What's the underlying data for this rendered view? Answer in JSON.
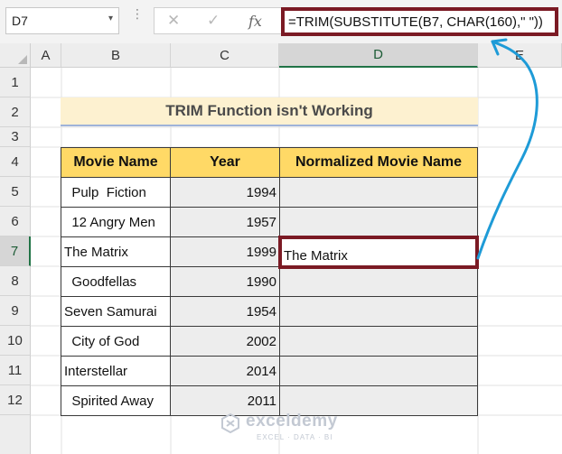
{
  "formula_bar": {
    "name_box": "D7",
    "name_box_arrow": "▾",
    "cancel_glyph": "✕",
    "enter_glyph": "✓",
    "fx_glyph": "fx",
    "formula": "=TRIM(SUBSTITUTE(B7, CHAR(160),\" \"))"
  },
  "columns": [
    "A",
    "B",
    "C",
    "D",
    "E"
  ],
  "rows": [
    "1",
    "2",
    "3",
    "4",
    "5",
    "6",
    "7",
    "8",
    "9",
    "10",
    "11",
    "12"
  ],
  "title": "TRIM Function isn't Working",
  "table": {
    "headers": [
      "Movie Name",
      "Year",
      "Normalized Movie Name"
    ],
    "rows": [
      {
        "name": "  Pulp  Fiction",
        "year": "1994",
        "normalized": ""
      },
      {
        "name": "  12 Angry Men",
        "year": "1957",
        "normalized": ""
      },
      {
        "name": "The Matrix",
        "year": "1999",
        "normalized": "The Matrix"
      },
      {
        "name": "  Goodfellas",
        "year": "1990",
        "normalized": ""
      },
      {
        "name": "Seven Samurai",
        "year": "1954",
        "normalized": ""
      },
      {
        "name": "  City of God",
        "year": "2002",
        "normalized": ""
      },
      {
        "name": "Interstellar",
        "year": "2014",
        "normalized": ""
      },
      {
        "name": "  Spirited Away",
        "year": "2011",
        "normalized": ""
      }
    ]
  },
  "active_cell": "D7",
  "watermark": {
    "name": "exceldemy",
    "tagline": "EXCEL · DATA · BI"
  },
  "colors": {
    "highlight": "#7b1a24",
    "header_fill": "#ffd966",
    "title_fill": "#fdf1d0",
    "arrow": "#1e9bd7"
  }
}
